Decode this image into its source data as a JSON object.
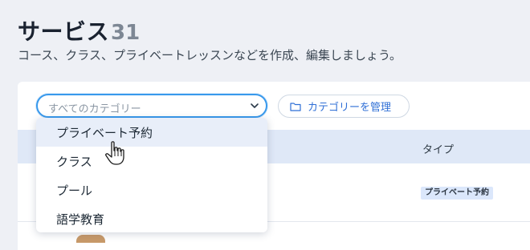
{
  "header": {
    "title": "サービス",
    "count": "31",
    "subtitle": "コース、クラス、プライベートレッスンなどを作成、編集しましょう。"
  },
  "filter": {
    "placeholder": "すべてのカテゴリー",
    "manage_label": "カテゴリーを管理"
  },
  "dropdown": {
    "items": [
      {
        "label": "プライベート予約",
        "hovered": true
      },
      {
        "label": "クラス"
      },
      {
        "label": "プール"
      },
      {
        "label": "語学教育"
      }
    ]
  },
  "table": {
    "type_header": "タイプ",
    "row_badge": "プライベート予約"
  },
  "colors": {
    "accent": "#3899ec",
    "header_bg": "#dfe8f7",
    "hover_bg": "#e8eef9"
  },
  "icons": [
    "chevron-down-icon",
    "folder-icon",
    "hand-pointer-cursor-icon"
  ]
}
